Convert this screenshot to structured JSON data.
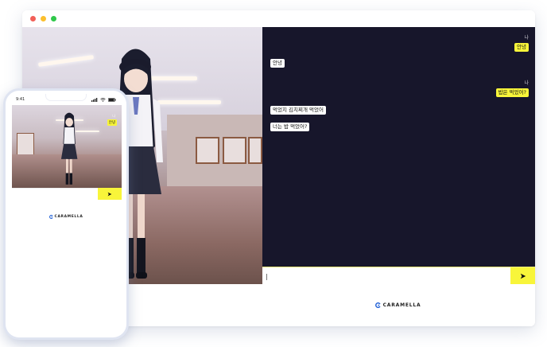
{
  "desktop": {
    "messages": [
      {
        "sender": "나",
        "text": "안녕",
        "from": "me"
      },
      {
        "sender": "",
        "text": "안녕",
        "from": "bot"
      },
      {
        "sender": "나",
        "text": "밥은 먹었어?",
        "from": "me"
      },
      {
        "sender": "",
        "text": "먹었지 김치찌개 먹었어",
        "from": "bot"
      },
      {
        "sender": "",
        "text": "너는 밥 먹었어?",
        "from": "bot"
      }
    ],
    "input": {
      "value": "|",
      "placeholder": ""
    },
    "send_icon": "send-arrow-icon",
    "brand": "CARAMELLA"
  },
  "phone": {
    "time": "9:41",
    "chat_sender": "나",
    "chat_bubble": "안녕",
    "input_value": "",
    "send_icon": "send-arrow-icon",
    "brand": "CARAMELLA"
  },
  "colors": {
    "accent": "#f8f53a",
    "chat_bg": "#17162b"
  }
}
